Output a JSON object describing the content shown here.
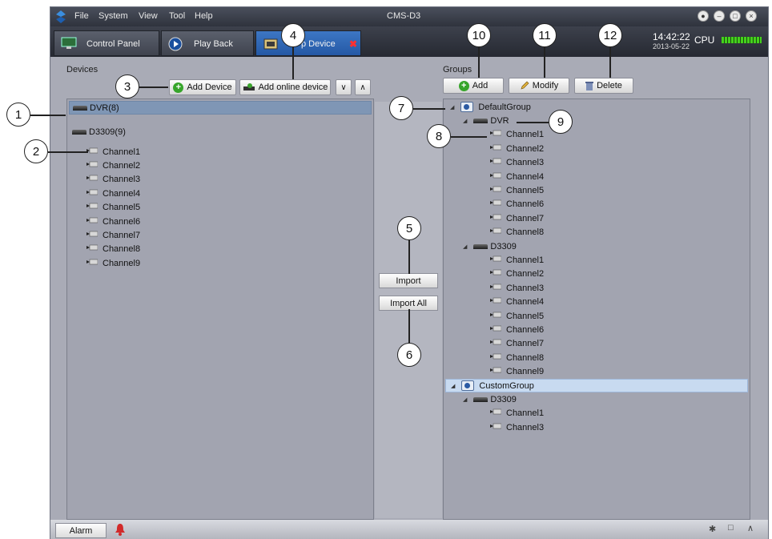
{
  "titlebar": {
    "title": "CMS-D3",
    "menu": [
      "File",
      "System",
      "View",
      "Tool",
      "Help"
    ]
  },
  "tabs": [
    {
      "label": "Control Panel",
      "icon": "monitor-icon"
    },
    {
      "label": "Play Back",
      "icon": "playback-icon"
    },
    {
      "label": "p Device",
      "icon": "device-setup-icon",
      "closable": true
    }
  ],
  "status": {
    "time": "14:42:22",
    "date": "2013-05-22",
    "cpu_label": "CPU"
  },
  "devices": {
    "label": "Devices",
    "add_device": "Add Device",
    "add_online_device": "Add online device",
    "expand_icon": "double-chevron-down",
    "collapse_icon": "double-chevron-up",
    "tree": [
      {
        "label": "DVR(8)",
        "selected": true
      },
      {
        "label": "D3309(9)",
        "channels": [
          "Channel1",
          "Channel2",
          "Channel3",
          "Channel4",
          "Channel5",
          "Channel6",
          "Channel7",
          "Channel8",
          "Channel9"
        ]
      }
    ]
  },
  "middle": {
    "import": "Import",
    "import_all": "Import All"
  },
  "groups": {
    "label": "Groups",
    "add": "Add",
    "modify": "Modify",
    "delete": "Delete",
    "tree": [
      {
        "label": "DefaultGroup",
        "devices": [
          {
            "label": "DVR",
            "channels": [
              "Channel1",
              "Channel2",
              "Channel3",
              "Channel4",
              "Channel5",
              "Channel6",
              "Channel7",
              "Channel8"
            ]
          },
          {
            "label": "D3309",
            "channels": [
              "Channel1",
              "Channel2",
              "Channel3",
              "Channel4",
              "Channel5",
              "Channel6",
              "Channel7",
              "Channel8",
              "Channel9"
            ]
          }
        ]
      },
      {
        "label": "CustomGroup",
        "selected": true,
        "devices": [
          {
            "label": "D3309",
            "channels": [
              "Channel1",
              "Channel3"
            ]
          }
        ]
      }
    ]
  },
  "bottom": {
    "alarm": "Alarm"
  },
  "callouts": [
    "1",
    "2",
    "3",
    "4",
    "5",
    "6",
    "7",
    "8",
    "9",
    "10",
    "11",
    "12"
  ],
  "colors": {
    "accent_tab": "#2f67b7",
    "selection": "#7f96b5",
    "cpu_meter": "#44d11c"
  }
}
